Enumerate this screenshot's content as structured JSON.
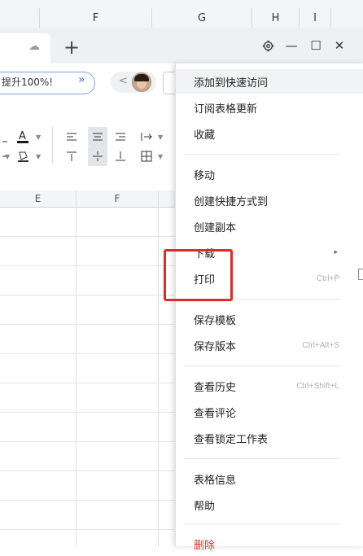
{
  "background_sheet": {
    "columns": [
      "F",
      "G",
      "H",
      "I"
    ]
  },
  "window": {
    "new_tab_label": "+",
    "settings_icon": "gear-icon",
    "minimize_label": "—",
    "maximize_label": "☐",
    "close_label": "✕"
  },
  "banner": {
    "text": "提升100%!",
    "chevron": "»"
  },
  "nav": {
    "back_label": "<"
  },
  "grid": {
    "columns": [
      "E",
      "F"
    ]
  },
  "menu": {
    "items": [
      {
        "label": "添加到快速访问",
        "shortcut": ""
      },
      {
        "label": "订阅表格更新",
        "shortcut": ""
      },
      {
        "label": "收藏",
        "shortcut": ""
      },
      {
        "label": "移动",
        "shortcut": ""
      },
      {
        "label": "创建快捷方式到",
        "shortcut": ""
      },
      {
        "label": "创建副本",
        "shortcut": ""
      },
      {
        "label": "下载",
        "shortcut": "",
        "has_submenu": true
      },
      {
        "label": "打印",
        "shortcut": "Ctrl+P"
      },
      {
        "label": "保存模板",
        "shortcut": ""
      },
      {
        "label": "保存版本",
        "shortcut": "Ctrl+Alt+S"
      },
      {
        "label": "查看历史",
        "shortcut": "Ctrl+Shift+L"
      },
      {
        "label": "查看评论",
        "shortcut": ""
      },
      {
        "label": "查看锁定工作表",
        "shortcut": ""
      },
      {
        "label": "表格信息",
        "shortcut": ""
      },
      {
        "label": "帮助",
        "shortcut": ""
      },
      {
        "label": "删除",
        "shortcut": ""
      }
    ],
    "submenu_arrow": "▸"
  },
  "colors": {
    "accent_blue": "#4a6fb5",
    "annotation_red": "#e02a2a",
    "danger_red": "#e0342a"
  }
}
